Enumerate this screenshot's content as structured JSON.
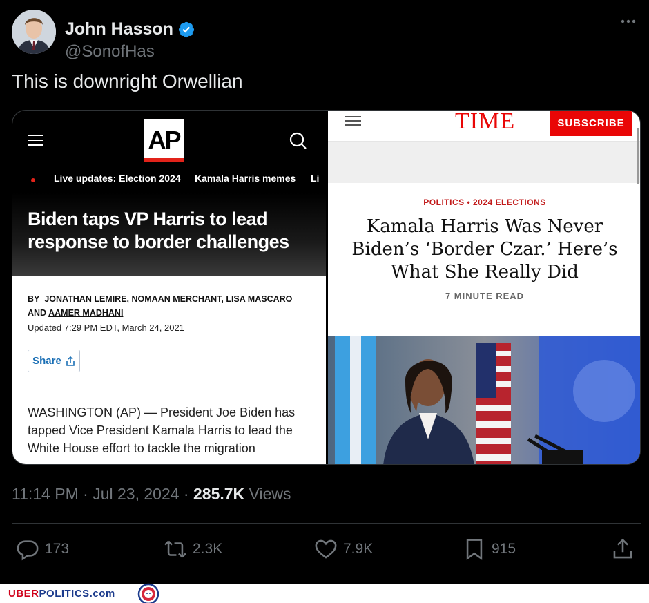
{
  "author": {
    "name": "John Hasson",
    "handle": "@SonofHas"
  },
  "tweet": {
    "text": "This is downright Orwellian"
  },
  "ap_article": {
    "logo": "AP",
    "nav": [
      "Live updates: Election 2024",
      "Kamala Harris memes",
      "Li"
    ],
    "headline": "Biden taps VP Harris to lead response to border challenges",
    "byline_prefix": "BY",
    "authors": [
      "JONATHAN LEMIRE",
      "NOMAAN MERCHANT",
      "LISA MASCARO",
      "AAMER MADHANI"
    ],
    "byline_and": "AND",
    "updated": "Updated 7:29 PM EDT, March 24, 2021",
    "share_label": "Share",
    "body": "WASHINGTON (AP) — President Joe Biden has tapped Vice President Kamala Harris to lead the White House effort to tackle the migration"
  },
  "time_article": {
    "logo": "TIME",
    "subscribe_label": "SUBSCRIBE",
    "kicker": "POLITICS • 2024 ELECTIONS",
    "headline": "Kamala Harris Was Never Biden’s ‘Border Czar.’ Here’s What She Really Did",
    "read_time": "7 MINUTE READ"
  },
  "meta": {
    "time": "11:14 PM",
    "date": "Jul 23, 2024",
    "views_count": "285.7K",
    "views_label": "Views"
  },
  "actions": {
    "replies": "173",
    "reposts": "2.3K",
    "likes": "7.9K",
    "bookmarks": "915"
  },
  "footer": {
    "brand_part1": "UBER",
    "brand_part2": "POLITICS.com"
  },
  "colors": {
    "verified": "#1d9bf0",
    "ap_red": "#e2231a",
    "time_red": "#e90606",
    "secondary_text": "#71767b"
  },
  "icons": [
    "verified-badge-icon",
    "more-options-icon",
    "menu-icon",
    "search-icon",
    "share-icon",
    "reply-icon",
    "repost-icon",
    "like-icon",
    "bookmark-icon",
    "share-upload-icon"
  ]
}
